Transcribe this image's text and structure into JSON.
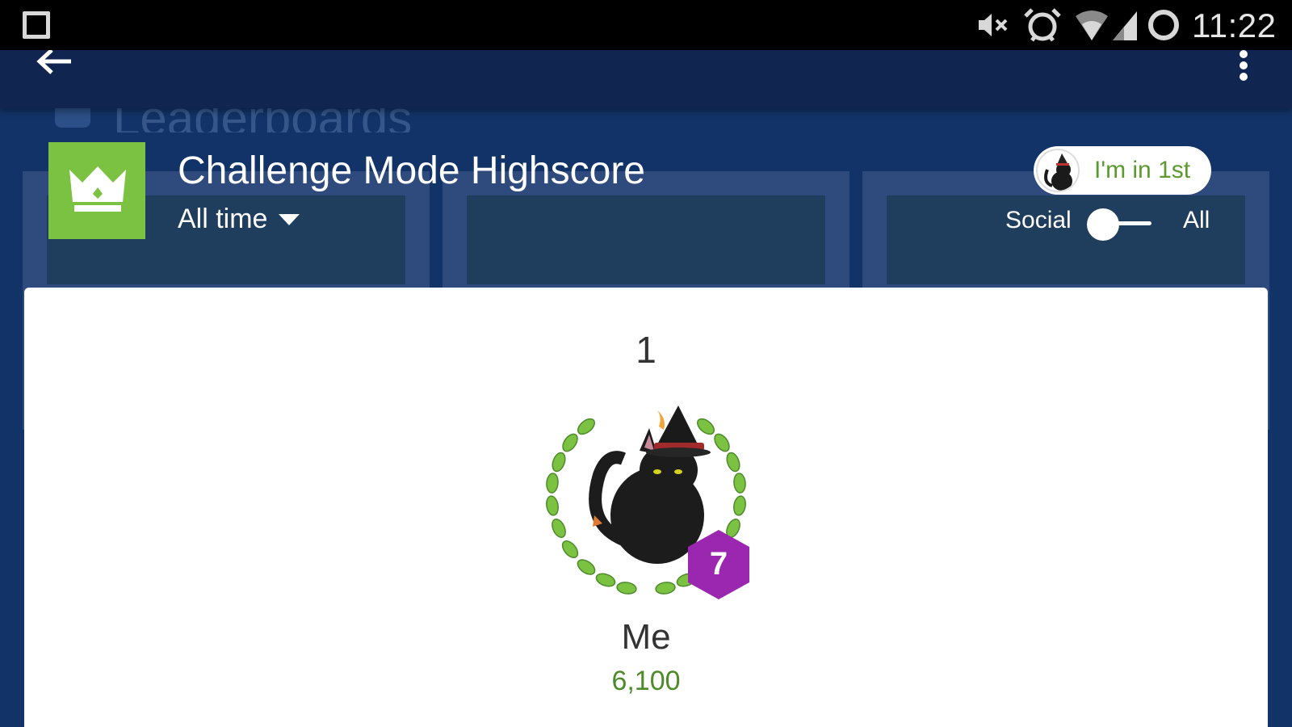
{
  "status_bar": {
    "time": "11:22",
    "icons": [
      "square-icon",
      "mute-icon",
      "alarm-icon",
      "wifi-icon",
      "signal-icon",
      "sync-icon"
    ]
  },
  "app_bar": {
    "back_icon": "arrow-left-icon",
    "menu_icon": "more-vert-icon"
  },
  "background": {
    "heading": "Leaderboards"
  },
  "leaderboard": {
    "title": "Challenge Mode Highscore",
    "timeframe": "All time",
    "badge_icon": "crown-icon",
    "badge_color": "#7cc242",
    "rank_pill": "I'm in 1st",
    "filter": {
      "left_label": "Social",
      "right_label": "All",
      "selected": "Social"
    }
  },
  "entry": {
    "rank": "1",
    "name": "Me",
    "score": "6,100",
    "level": "7",
    "level_color": "#9b27b0",
    "laurel_color": "#7cc242",
    "score_color": "#4d8a2a"
  },
  "colors": {
    "background": "#123368",
    "app_bar": "#10254f",
    "accent_green": "#7cc242"
  }
}
